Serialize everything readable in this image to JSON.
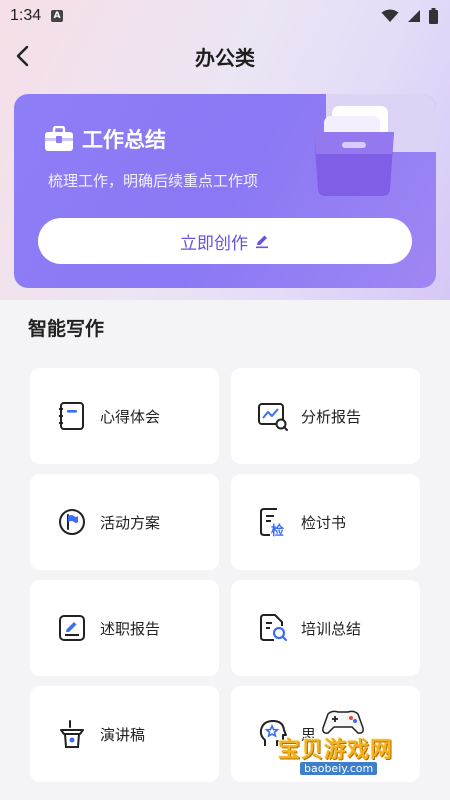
{
  "status_bar": {
    "time": "1:34",
    "notif_letter": "A"
  },
  "nav": {
    "title": "办公类"
  },
  "banner": {
    "title": "工作总结",
    "subtitle": "梳理工作，明确后续重点工作项",
    "button_label": "立即创作"
  },
  "section": {
    "title": "智能写作"
  },
  "cards": [
    {
      "label": "心得体会",
      "icon": "notebook-icon"
    },
    {
      "label": "分析报告",
      "icon": "chart-search-icon"
    },
    {
      "label": "活动方案",
      "icon": "flag-icon"
    },
    {
      "label": "检讨书",
      "icon": "review-doc-icon"
    },
    {
      "label": "述职报告",
      "icon": "edit-doc-icon"
    },
    {
      "label": "培训总结",
      "icon": "search-doc-icon"
    },
    {
      "label": "演讲稿",
      "icon": "podium-icon"
    },
    {
      "label": "思",
      "icon": "head-star-icon"
    }
  ],
  "watermark": {
    "text": "宝贝游戏网",
    "url": "baobeiy.com"
  },
  "colors": {
    "accent": "#6a4fe0",
    "banner": "#8a78f4",
    "icon_blue": "#3b6ef5"
  }
}
